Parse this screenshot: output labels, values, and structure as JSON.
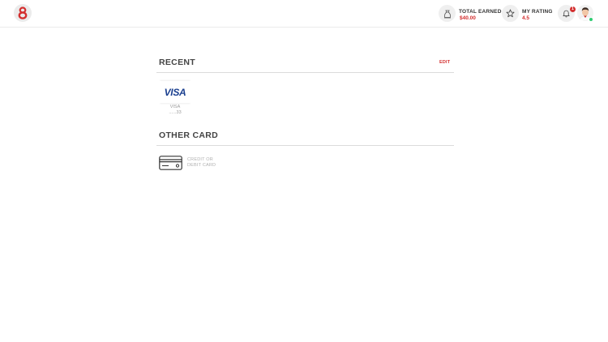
{
  "header": {
    "logo_glyph": "8",
    "total_earned": {
      "label": "TOTAL EARNED",
      "value": "$40.00",
      "icon": "money-bag-icon"
    },
    "my_rating": {
      "label": "MY RATING",
      "value": "4.5",
      "icon": "star-icon"
    },
    "notifications": {
      "count": "1",
      "icon": "bell-icon"
    },
    "avatar": {
      "status_color": "#2ecc71"
    }
  },
  "recent": {
    "title": "RECENT",
    "edit_label": "EDIT",
    "cards": [
      {
        "logo_text": "VISA",
        "brand": "VISA",
        "last_digits": "......33"
      }
    ]
  },
  "other": {
    "title": "OTHER CARD",
    "option_line1": "CREDIT OR",
    "option_line2": "DEBIT CARD"
  },
  "colors": {
    "accent": "#d32f2f",
    "visa_blue": "#1a3f8f",
    "divider": "#dcdcdc"
  }
}
